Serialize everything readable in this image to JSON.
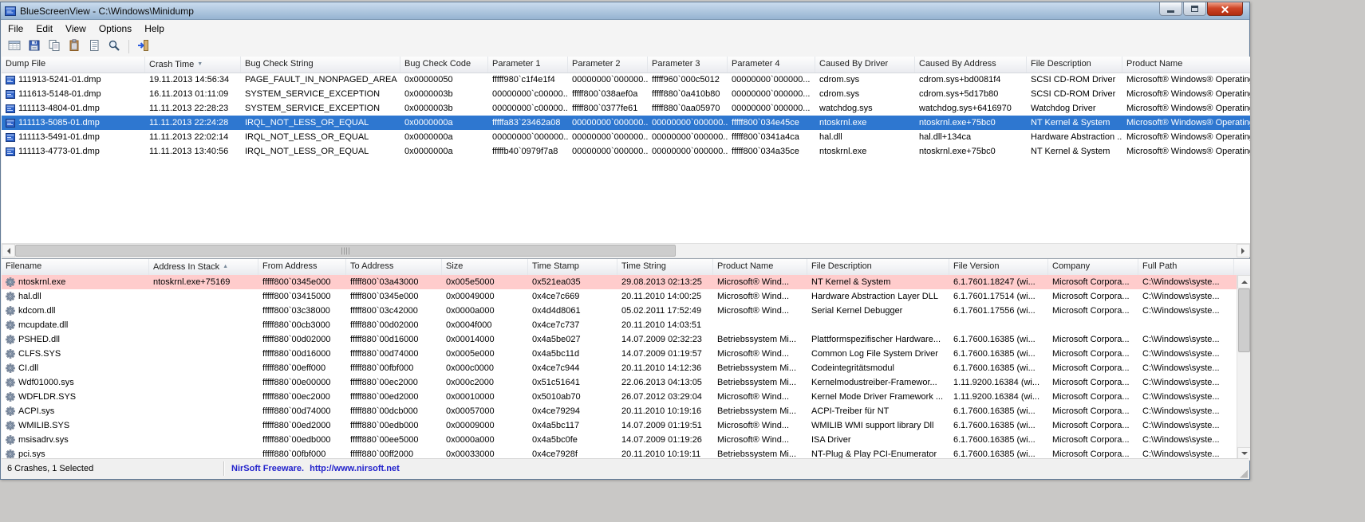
{
  "window": {
    "title": "BlueScreenView - C:\\Windows\\Minidump",
    "controls": [
      "minimize",
      "maximize",
      "close"
    ]
  },
  "menu": {
    "items": [
      "File",
      "Edit",
      "View",
      "Options",
      "Help"
    ]
  },
  "toolbar": {
    "icons": [
      "report-view-icon",
      "save-icon",
      "copy-icon",
      "clipboard-icon",
      "properties-icon",
      "find-icon",
      "exit-icon"
    ]
  },
  "upper_table": {
    "columns": [
      "Dump File",
      "Crash Time",
      "Bug Check String",
      "Bug Check Code",
      "Parameter 1",
      "Parameter 2",
      "Parameter 3",
      "Parameter 4",
      "Caused By Driver",
      "Caused By Address",
      "File Description",
      "Product Name"
    ],
    "sort": {
      "column": "Crash Time",
      "dir": "desc"
    },
    "selected_index": 3,
    "rows": [
      [
        "111913-5241-01.dmp",
        "19.11.2013 14:56:34",
        "PAGE_FAULT_IN_NONPAGED_AREA",
        "0x00000050",
        "fffff980`c1f4e1f4",
        "00000000`000000...",
        "fffff960`000c5012",
        "00000000`000000...",
        "cdrom.sys",
        "cdrom.sys+bd0081f4",
        "SCSI CD-ROM Driver",
        "Microsoft® Windows® Operating Sy"
      ],
      [
        "111613-5148-01.dmp",
        "16.11.2013 01:11:09",
        "SYSTEM_SERVICE_EXCEPTION",
        "0x0000003b",
        "00000000`c00000...",
        "fffff800`038aef0a",
        "fffff880`0a410b80",
        "00000000`000000...",
        "cdrom.sys",
        "cdrom.sys+5d17b80",
        "SCSI CD-ROM Driver",
        "Microsoft® Windows® Operating Sy"
      ],
      [
        "111113-4804-01.dmp",
        "11.11.2013 22:28:23",
        "SYSTEM_SERVICE_EXCEPTION",
        "0x0000003b",
        "00000000`c00000...",
        "fffff800`0377fe61",
        "fffff880`0aa05970",
        "00000000`000000...",
        "watchdog.sys",
        "watchdog.sys+6416970",
        "Watchdog Driver",
        "Microsoft® Windows® Operating Sy"
      ],
      [
        "111113-5085-01.dmp",
        "11.11.2013 22:24:28",
        "IRQL_NOT_LESS_OR_EQUAL",
        "0x0000000a",
        "fffffa83`23462a08",
        "00000000`000000...",
        "00000000`000000...",
        "fffff800`034e45ce",
        "ntoskrnl.exe",
        "ntoskrnl.exe+75bc0",
        "NT Kernel & System",
        "Microsoft® Windows® Operating Sy"
      ],
      [
        "111113-5491-01.dmp",
        "11.11.2013 22:02:14",
        "IRQL_NOT_LESS_OR_EQUAL",
        "0x0000000a",
        "00000000`000000...",
        "00000000`000000...",
        "00000000`000000...",
        "fffff800`0341a4ca",
        "hal.dll",
        "hal.dll+134ca",
        "Hardware Abstraction ...",
        "Microsoft® Windows® Operating Sy"
      ],
      [
        "111113-4773-01.dmp",
        "11.11.2013 13:40:56",
        "IRQL_NOT_LESS_OR_EQUAL",
        "0x0000000a",
        "fffffb40`0979f7a8",
        "00000000`000000...",
        "00000000`000000...",
        "fffff800`034a35ce",
        "ntoskrnl.exe",
        "ntoskrnl.exe+75bc0",
        "NT Kernel & System",
        "Microsoft® Windows® Operating Sy"
      ]
    ]
  },
  "lower_table": {
    "columns": [
      "Filename",
      "Address In Stack",
      "From Address",
      "To Address",
      "Size",
      "Time Stamp",
      "Time String",
      "Product Name",
      "File Description",
      "File Version",
      "Company",
      "Full Path"
    ],
    "sort": {
      "column": "Address In Stack",
      "dir": "asc"
    },
    "highlighted_index": 0,
    "rows": [
      [
        "ntoskrnl.exe",
        "ntoskrnl.exe+75169",
        "fffff800`0345e000",
        "fffff800`03a43000",
        "0x005e5000",
        "0x521ea035",
        "29.08.2013 02:13:25",
        "Microsoft® Wind...",
        "NT Kernel & System",
        "6.1.7601.18247 (wi...",
        "Microsoft Corpora...",
        "C:\\Windows\\syste..."
      ],
      [
        "hal.dll",
        "",
        "fffff800`03415000",
        "fffff800`0345e000",
        "0x00049000",
        "0x4ce7c669",
        "20.11.2010 14:00:25",
        "Microsoft® Wind...",
        "Hardware Abstraction Layer DLL",
        "6.1.7601.17514 (wi...",
        "Microsoft Corpora...",
        "C:\\Windows\\syste..."
      ],
      [
        "kdcom.dll",
        "",
        "fffff800`03c38000",
        "fffff800`03c42000",
        "0x0000a000",
        "0x4d4d8061",
        "05.02.2011 17:52:49",
        "Microsoft® Wind...",
        "Serial Kernel Debugger",
        "6.1.7601.17556 (wi...",
        "Microsoft Corpora...",
        "C:\\Windows\\syste..."
      ],
      [
        "mcupdate.dll",
        "",
        "fffff880`00cb3000",
        "fffff880`00d02000",
        "0x0004f000",
        "0x4ce7c737",
        "20.11.2010 14:03:51",
        "",
        "",
        "",
        "",
        ""
      ],
      [
        "PSHED.dll",
        "",
        "fffff880`00d02000",
        "fffff880`00d16000",
        "0x00014000",
        "0x4a5be027",
        "14.07.2009 02:32:23",
        "Betriebssystem Mi...",
        "Plattformspezifischer Hardware...",
        "6.1.7600.16385 (wi...",
        "Microsoft Corpora...",
        "C:\\Windows\\syste..."
      ],
      [
        "CLFS.SYS",
        "",
        "fffff880`00d16000",
        "fffff880`00d74000",
        "0x0005e000",
        "0x4a5bc11d",
        "14.07.2009 01:19:57",
        "Microsoft® Wind...",
        "Common Log File System Driver",
        "6.1.7600.16385 (wi...",
        "Microsoft Corpora...",
        "C:\\Windows\\syste..."
      ],
      [
        "CI.dll",
        "",
        "fffff880`00eff000",
        "fffff880`00fbf000",
        "0x000c0000",
        "0x4ce7c944",
        "20.11.2010 14:12:36",
        "Betriebssystem Mi...",
        "Codeintegritätsmodul",
        "6.1.7600.16385 (wi...",
        "Microsoft Corpora...",
        "C:\\Windows\\syste..."
      ],
      [
        "Wdf01000.sys",
        "",
        "fffff880`00e00000",
        "fffff880`00ec2000",
        "0x000c2000",
        "0x51c51641",
        "22.06.2013 04:13:05",
        "Betriebssystem Mi...",
        "Kernelmodustreiber-Framewor...",
        "1.11.9200.16384 (wi...",
        "Microsoft Corpora...",
        "C:\\Windows\\syste..."
      ],
      [
        "WDFLDR.SYS",
        "",
        "fffff880`00ec2000",
        "fffff880`00ed2000",
        "0x00010000",
        "0x5010ab70",
        "26.07.2012 03:29:04",
        "Microsoft® Wind...",
        "Kernel Mode Driver Framework ...",
        "1.11.9200.16384 (wi...",
        "Microsoft Corpora...",
        "C:\\Windows\\syste..."
      ],
      [
        "ACPI.sys",
        "",
        "fffff880`00d74000",
        "fffff880`00dcb000",
        "0x00057000",
        "0x4ce79294",
        "20.11.2010 10:19:16",
        "Betriebssystem Mi...",
        "ACPI-Treiber für NT",
        "6.1.7600.16385 (wi...",
        "Microsoft Corpora...",
        "C:\\Windows\\syste..."
      ],
      [
        "WMILIB.SYS",
        "",
        "fffff880`00ed2000",
        "fffff880`00edb000",
        "0x00009000",
        "0x4a5bc117",
        "14.07.2009 01:19:51",
        "Microsoft® Wind...",
        "WMILIB WMI support library Dll",
        "6.1.7600.16385 (wi...",
        "Microsoft Corpora...",
        "C:\\Windows\\syste..."
      ],
      [
        "msisadrv.sys",
        "",
        "fffff880`00edb000",
        "fffff880`00ee5000",
        "0x0000a000",
        "0x4a5bc0fe",
        "14.07.2009 01:19:26",
        "Microsoft® Wind...",
        "ISA Driver",
        "6.1.7600.16385 (wi...",
        "Microsoft Corpora...",
        "C:\\Windows\\syste..."
      ],
      [
        "pci.sys",
        "",
        "fffff880`00fbf000",
        "fffff880`00ff2000",
        "0x00033000",
        "0x4ce7928f",
        "20.11.2010 10:19:11",
        "Betriebssystem Mi...",
        "NT-Plug & Play PCI-Enumerator",
        "6.1.7600.16385 (wi...",
        "Microsoft Corpora...",
        "C:\\Windows\\syste..."
      ]
    ]
  },
  "status_bar": {
    "crashes_text": "6 Crashes, 1 Selected",
    "brand": "NirSoft Freeware.",
    "url": "http://www.nirsoft.net"
  },
  "colors": {
    "titlebar_top": "#cadcee",
    "titlebar_bottom": "#96b3d1",
    "selection_bg": "#2e77d0",
    "flagged_row_bg": "#ffcccc",
    "link_blue": "#2323cc",
    "close_button_red": "#cf4628",
    "header_border": "#d5d9de"
  }
}
